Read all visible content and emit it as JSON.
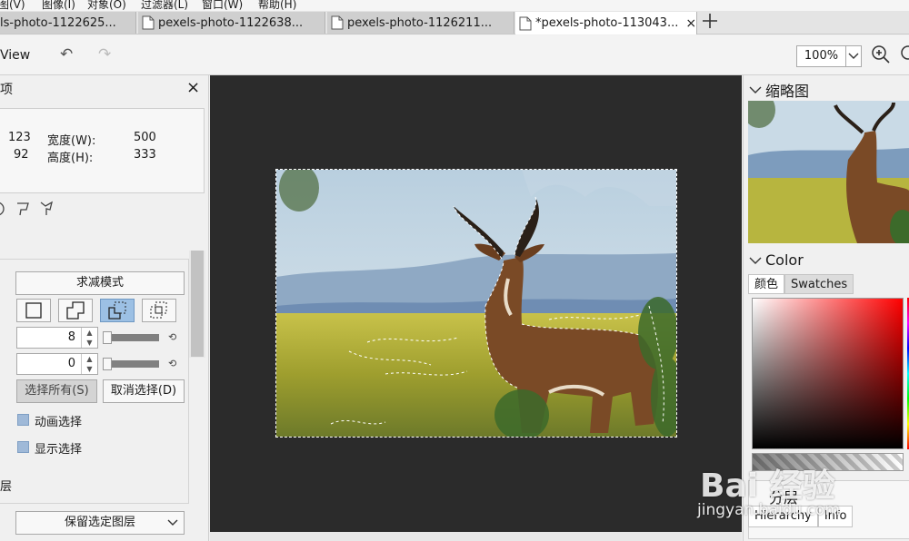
{
  "menubar": {
    "items": [
      "图(V)",
      "图像(I)",
      "对象(O)",
      "过滤器(L)",
      "窗口(W)",
      "帮助(H)"
    ]
  },
  "tabs": [
    {
      "label": "ls-photo-1122625..."
    },
    {
      "label": "pexels-photo-1122638..."
    },
    {
      "label": "pexels-photo-1126211..."
    },
    {
      "label": "*pexels-photo-113043...",
      "close": "×"
    }
  ],
  "toolbar": {
    "view_label": "View",
    "undo": "↶",
    "redo": "↷",
    "zoom_value": "100%"
  },
  "left_panel": {
    "title": "项",
    "close": "×",
    "x_value": "123",
    "y_value": "92",
    "width_label": "宽度(W):",
    "width_value": "500",
    "height_label": "高度(H):",
    "height_value": "333",
    "mode_button": "求减模式",
    "spin1_value": "8",
    "spin2_value": "0",
    "select_all": "选择所有(S)",
    "deselect": "取消选择(D)",
    "animate_label": "动画选择",
    "show_label": "显示选择",
    "section2": "层",
    "keep_layer": "保留选定图层"
  },
  "right_panel": {
    "thumbnail_title": "缩略图",
    "color_title": "Color",
    "color_tabs": [
      "颜色",
      "Swatches"
    ],
    "layers_title": "分层",
    "layer_tabs": [
      "Hierarchy",
      "Info"
    ]
  },
  "watermark": {
    "line1": "Bai 经验",
    "line2": "jingyan.baidu.com"
  },
  "colors": {
    "canvas_bg": "#2b2b2b",
    "selected_op": "#9cc0e4",
    "checkbox": "#9fb9d8"
  }
}
